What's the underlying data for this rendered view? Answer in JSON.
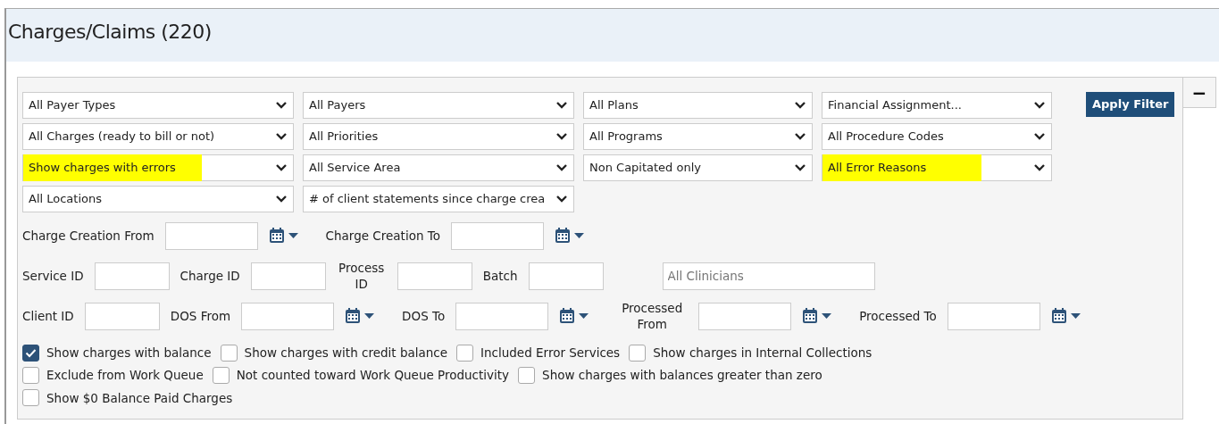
{
  "page_title": "Charges/Claims (220)",
  "apply_button": "Apply Filter",
  "collapse_button": "−",
  "dropdown_rows": [
    [
      {
        "value": "All Payer Types",
        "highlighted": false
      },
      {
        "value": "All Payers",
        "highlighted": false
      },
      {
        "value": "All Plans",
        "highlighted": false
      },
      {
        "value": "Financial Assignment...",
        "highlighted": false
      }
    ],
    [
      {
        "value": "All Charges (ready to bill or not)",
        "highlighted": false
      },
      {
        "value": "All Priorities",
        "highlighted": false
      },
      {
        "value": "All Programs",
        "highlighted": false
      },
      {
        "value": "All Procedure Codes",
        "highlighted": false
      }
    ],
    [
      {
        "value": "Show charges with errors",
        "highlighted": true
      },
      {
        "value": "All Service Area",
        "highlighted": false
      },
      {
        "value": "Non Capitated only",
        "highlighted": false
      },
      {
        "value": "All Error Reasons",
        "highlighted": true
      }
    ],
    [
      {
        "value": "All Locations",
        "highlighted": false
      },
      {
        "value": "# of client statements since charge crea",
        "highlighted": false
      }
    ]
  ],
  "field_rows": [
    [
      {
        "kind": "date",
        "label": "Charge Creation From"
      },
      {
        "kind": "date",
        "label": "Charge Creation To"
      }
    ],
    [
      {
        "kind": "text",
        "label": "Service ID"
      },
      {
        "kind": "text",
        "label": "Charge ID"
      },
      {
        "kind": "text",
        "label": "Process ID",
        "wrap": true
      },
      {
        "kind": "text",
        "label": "Batch"
      },
      {
        "kind": "search",
        "placeholder": "All Clinicians"
      }
    ],
    [
      {
        "kind": "text",
        "label": "Client ID"
      },
      {
        "kind": "date",
        "label": "DOS From"
      },
      {
        "kind": "date",
        "label": "DOS To"
      },
      {
        "kind": "date",
        "label": "Processed From",
        "wrap": true
      },
      {
        "kind": "date",
        "label": "Processed To"
      }
    ]
  ],
  "checkbox_rows": [
    [
      {
        "label": "Show charges with balance",
        "checked": true
      },
      {
        "label": "Show charges with credit balance",
        "checked": false
      },
      {
        "label": "Included Error Services",
        "checked": false
      },
      {
        "label": "Show charges in Internal Collections",
        "checked": false
      }
    ],
    [
      {
        "label": "Exclude from Work Queue",
        "checked": false
      },
      {
        "label": "Not counted toward Work Queue Productivity",
        "checked": false
      },
      {
        "label": "Show charges with balances greater than zero",
        "checked": false
      }
    ],
    [
      {
        "label": "Show $0 Balance Paid Charges",
        "checked": false
      }
    ]
  ]
}
